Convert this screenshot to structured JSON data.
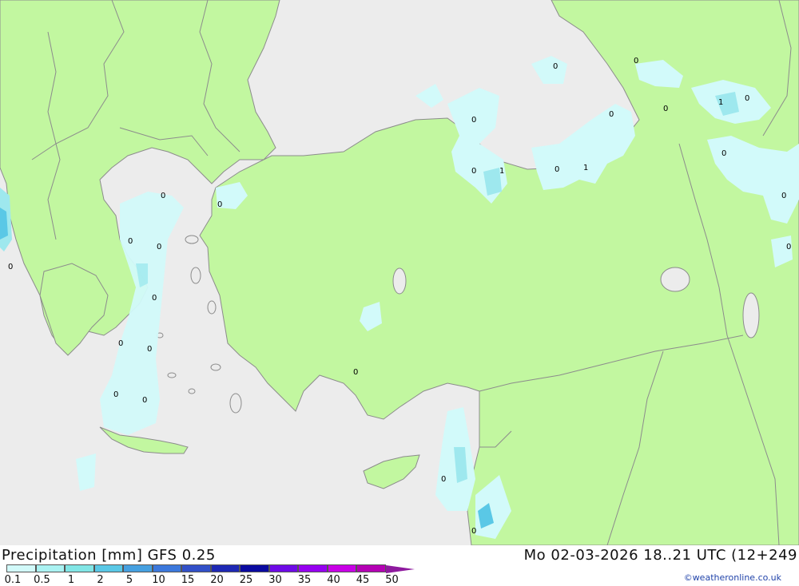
{
  "title_left": "Precipitation [mm] GFS 0.25",
  "title_right": "Mo 02-03-2026 18..21 UTC (12+249",
  "credit": "©weatheronline.co.uk",
  "legend": [
    {
      "label": "0.1",
      "color": "#d2fafa"
    },
    {
      "label": "0.5",
      "color": "#aaf2f2"
    },
    {
      "label": "1",
      "color": "#82e6e6"
    },
    {
      "label": "2",
      "color": "#5ac8e6"
    },
    {
      "label": "5",
      "color": "#46a0e0"
    },
    {
      "label": "10",
      "color": "#3c78dc"
    },
    {
      "label": "15",
      "color": "#3250c8"
    },
    {
      "label": "20",
      "color": "#1e28b4"
    },
    {
      "label": "25",
      "color": "#0a0aa0"
    },
    {
      "label": "30",
      "color": "#6e0ae6"
    },
    {
      "label": "35",
      "color": "#9600f0"
    },
    {
      "label": "40",
      "color": "#c800e6"
    },
    {
      "label": "45",
      "color": "#b400b4"
    },
    {
      "label": "50",
      "color": "#8e1a9e"
    }
  ],
  "colors": {
    "land": "#c2f7a0",
    "sea": "#ececec",
    "border": "#8c8c8c",
    "light_precip": "#d2fafa",
    "mid_precip": "#9ee8ee",
    "strong_precip": "#5ac8e6"
  },
  "map_values": [
    "0",
    "0",
    "0",
    "1",
    "0",
    "0",
    "0",
    "1",
    "0",
    "0",
    "1",
    "0",
    "0",
    "0",
    "0",
    "0",
    "0",
    "0",
    "0",
    "0",
    "0",
    "0",
    "0",
    "0",
    "0",
    "0",
    "0",
    "0"
  ]
}
